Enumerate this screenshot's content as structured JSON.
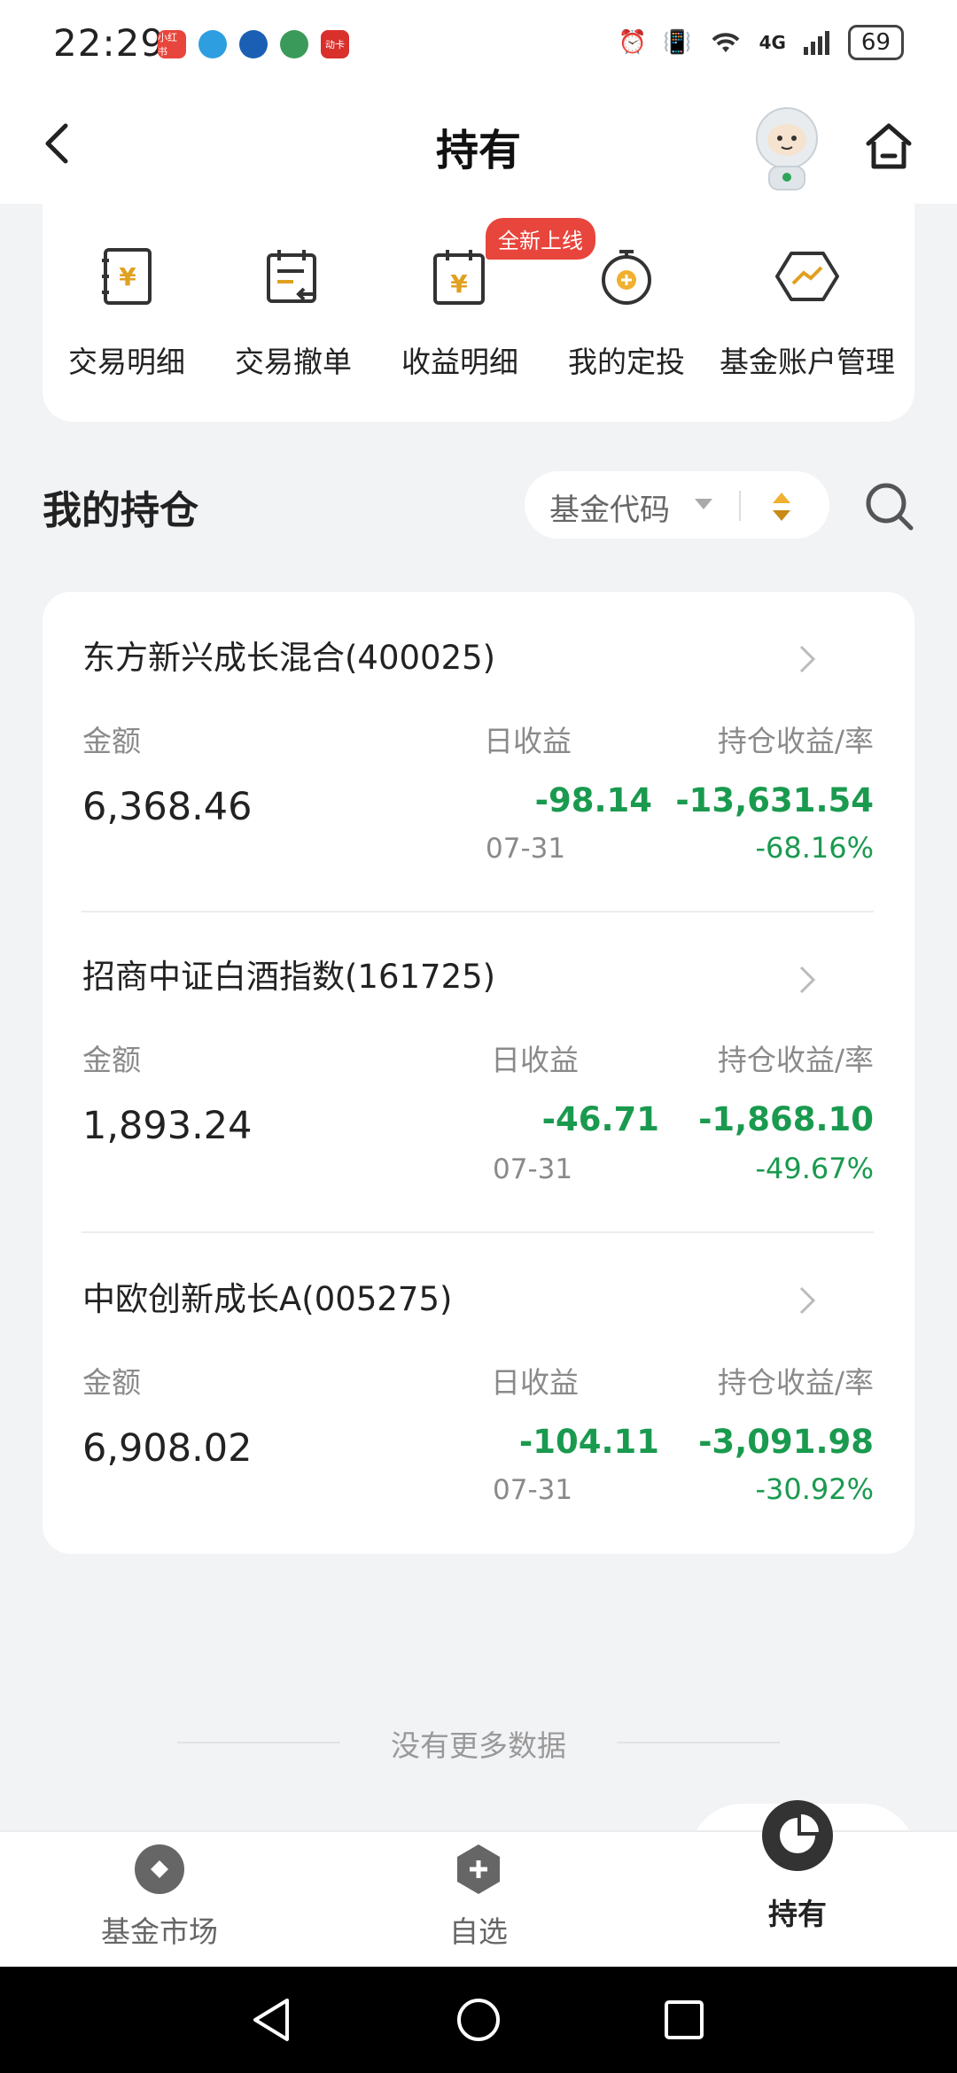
{
  "status": {
    "time": "22:29",
    "network": "4G",
    "battery": "69",
    "app_icons": [
      "小红书",
      "app-2",
      "app-3",
      "app-4",
      "动卡"
    ]
  },
  "header": {
    "title": "持有"
  },
  "quick": {
    "badge": "全新上线",
    "items": [
      {
        "label": "交易明细",
        "icon": "yuan-notebook-icon"
      },
      {
        "label": "交易撤单",
        "icon": "calendar-undo-icon"
      },
      {
        "label": "收益明细",
        "icon": "yuan-calendar-icon"
      },
      {
        "label": "我的定投",
        "icon": "stopwatch-plus-icon"
      },
      {
        "label": "基金账户管理",
        "icon": "hexagon-trend-icon"
      }
    ]
  },
  "holdings": {
    "title": "我的持仓",
    "sort_label": "基金代码"
  },
  "funds": [
    {
      "name": "东方新兴成长混合(400025)",
      "label_amount": "金额",
      "label_daily": "日收益",
      "label_total": "持仓收益/率",
      "amount": "6,368.46",
      "daily": "-98.14",
      "date": "07-31",
      "total": "-13,631.54",
      "rate": "-68.16%"
    },
    {
      "name": "招商中证白酒指数(161725)",
      "label_amount": "金额",
      "label_daily": "日收益",
      "label_total": "持仓收益/率",
      "amount": "1,893.24",
      "daily": "-46.71",
      "date": "07-31",
      "total": "-1,868.10",
      "rate": "-49.67%"
    },
    {
      "name": "中欧创新成长A(005275)",
      "label_amount": "金额",
      "label_daily": "日收益",
      "label_total": "持仓收益/率",
      "amount": "6,908.02",
      "daily": "-104.11",
      "date": "07-31",
      "total": "-3,091.98",
      "rate": "-30.92%"
    }
  ],
  "footer": {
    "no_more": "没有更多数据"
  },
  "tabs": [
    {
      "label": "基金市场",
      "icon": "fund-market-icon"
    },
    {
      "label": "自选",
      "icon": "watchlist-plus-icon"
    },
    {
      "label": "持有",
      "icon": "holdings-pie-icon",
      "active": true
    }
  ],
  "colors": {
    "loss_green": "#1a9a4f",
    "badge_red": "#e8453c",
    "active_tab": "#333333"
  }
}
